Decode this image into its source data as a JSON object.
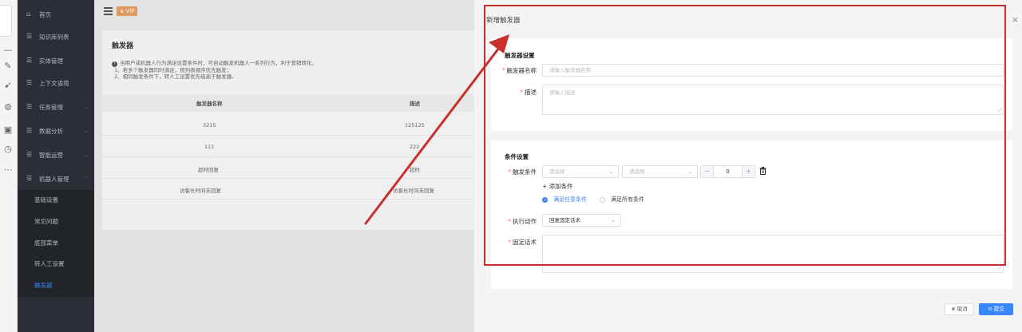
{
  "sidebar": {
    "items": [
      {
        "label": "首页",
        "icon": "home-icon",
        "chevron": false
      },
      {
        "label": "知识库列表",
        "icon": "list-icon",
        "chevron": false
      },
      {
        "label": "实体管理",
        "icon": "list-icon",
        "chevron": false
      },
      {
        "label": "上下文语境",
        "icon": "list-icon",
        "chevron": false
      },
      {
        "label": "任务管理",
        "icon": "list-icon",
        "chevron": true
      },
      {
        "label": "数据分析",
        "icon": "list-icon",
        "chevron": true
      },
      {
        "label": "智能运营",
        "icon": "list-icon",
        "chevron": true
      },
      {
        "label": "机器人管理",
        "icon": "list-icon",
        "chevron": true
      }
    ],
    "submenu": [
      "基础设置",
      "常见问题",
      "底部菜单",
      "转人工设置",
      "触发器"
    ],
    "active_submenu": "触发器"
  },
  "topbar": {
    "vip_label": "VIP"
  },
  "page": {
    "title": "触发器",
    "tips": [
      "当用户或机器人行为满足设置条件时，可自动触发机器人一系列行为，利于营销转化。",
      "1、若多个触发器同时满足，按列表顺序优先触发；",
      "2、相同触发条件下，转人工设置优先级高于触发器。"
    ],
    "table": {
      "columns": [
        "触发器名称",
        "描述"
      ],
      "rows": [
        [
          "3215",
          "125125"
        ],
        [
          "111",
          "222"
        ],
        [
          "超时回复",
          "超时"
        ],
        [
          "访客长时间未回复",
          "访客长时间未回复"
        ]
      ]
    }
  },
  "drawer": {
    "title": "新增触发器",
    "close": "×",
    "trigger_section": {
      "title": "触发器设置",
      "name_label": "触发器名称",
      "name_placeholder": "请输入触发器名称",
      "desc_label": "描述",
      "desc_placeholder": "请输入描述"
    },
    "condition_section": {
      "title": "条件设置",
      "trigger_cond_label": "触发条件",
      "select1_placeholder": "请选择",
      "select2_placeholder": "请选择",
      "stepper_value": "0",
      "stepper_minus": "−",
      "stepper_plus": "+",
      "add_condition": "+ 添加条件",
      "radio_any": "满足任意条件",
      "radio_all": "满足所有条件",
      "radio_selected": "any",
      "action_label": "执行动作",
      "action_value": "回复固定话术",
      "fixed_text_label": "固定话术"
    },
    "buttons": {
      "cancel": "取消",
      "submit": "提交"
    }
  },
  "colors": {
    "accent": "#3a86ff",
    "annotation": "#c9302c",
    "required": "#f56c6c",
    "sidebar": "#2a2d34",
    "vip": "#e8a063"
  }
}
